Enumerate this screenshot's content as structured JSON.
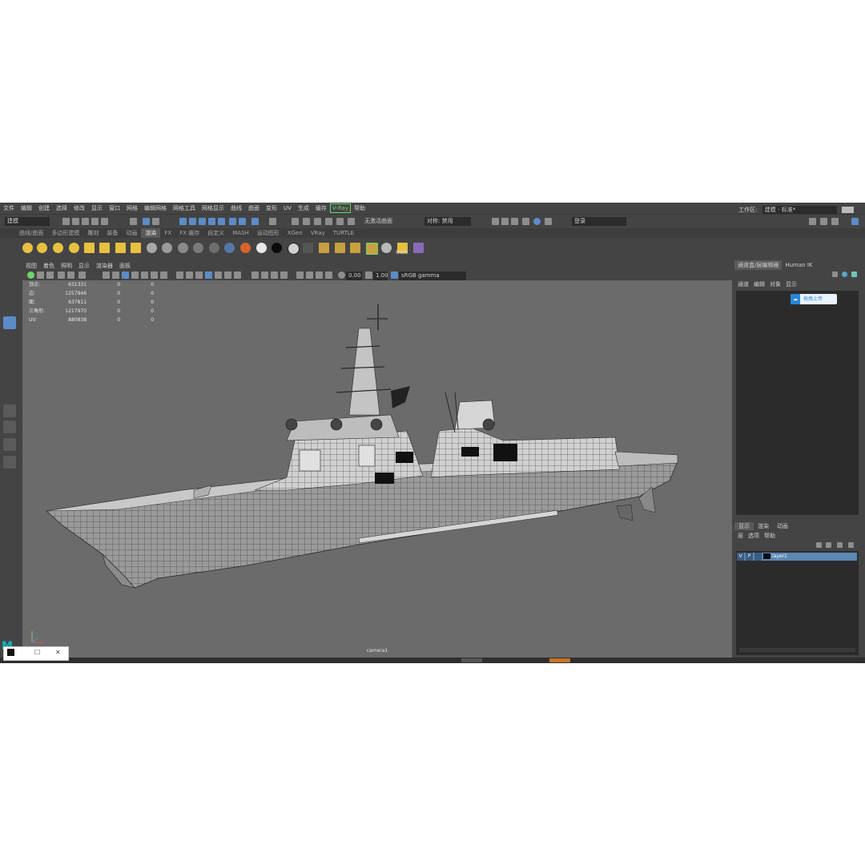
{
  "menubar": {
    "items": [
      "文件",
      "编辑",
      "创建",
      "选择",
      "修改",
      "显示",
      "窗口",
      "网格",
      "编辑网格",
      "网格工具",
      "网格显示",
      "曲线",
      "曲面",
      "变形",
      "UV",
      "生成",
      "缓存",
      "V-Ray",
      "帮助"
    ],
    "workspace_label": "工作区:",
    "workspace_value": "建模 - 标准*"
  },
  "statusbar": {
    "mode": "建模",
    "no_live_surface": "无激活曲面",
    "symmetry": "对称: 禁用",
    "login": "登录"
  },
  "shelf": {
    "tabs": [
      "曲线/曲面",
      "多边形建模",
      "雕刻",
      "装备",
      "动画",
      "渲染",
      "FX",
      "FX 缓存",
      "自定义",
      "MASH",
      "运动图形",
      "XGen",
      "VRay",
      "TURTLE"
    ],
    "active_tab": "渲染",
    "export_label": "导出到"
  },
  "viewport": {
    "menu": [
      "视图",
      "着色",
      "照明",
      "显示",
      "渲染器",
      "面板"
    ],
    "exposure": "0.00",
    "gamma": "1.00",
    "color_space": "sRGB gamma",
    "camera": "camera1",
    "hud": [
      {
        "label": "顶点:",
        "value": "631331",
        "v2": "0",
        "v3": "0"
      },
      {
        "label": "边:",
        "value": "1257946",
        "v2": "0",
        "v3": "0"
      },
      {
        "label": "面:",
        "value": "637811",
        "v2": "0",
        "v3": "0"
      },
      {
        "label": "三角形:",
        "value": "1217970",
        "v2": "0",
        "v3": "0"
      },
      {
        "label": "UV:",
        "value": "880838",
        "v2": "0",
        "v3": "0"
      }
    ]
  },
  "channel_box": {
    "tabs": [
      "通道盒/层编辑器",
      "Human IK"
    ],
    "menu": [
      "通道",
      "编辑",
      "对象",
      "显示"
    ],
    "upload_label": "拖拽上传"
  },
  "layer_editor": {
    "tabs": [
      "显示",
      "渲染",
      "动画"
    ],
    "menu": [
      "层",
      "选项",
      "帮助"
    ],
    "layer": {
      "v": "V",
      "p": "P",
      "name": "layer1"
    }
  },
  "window_controls": {
    "minimize": "—",
    "maximize": "☐",
    "close": "✕"
  },
  "colors": {
    "accent": "#5b8cc8",
    "vray": "#6bd46b",
    "viewport_bg": "#6b6b6b",
    "ui_bg": "#444444"
  }
}
